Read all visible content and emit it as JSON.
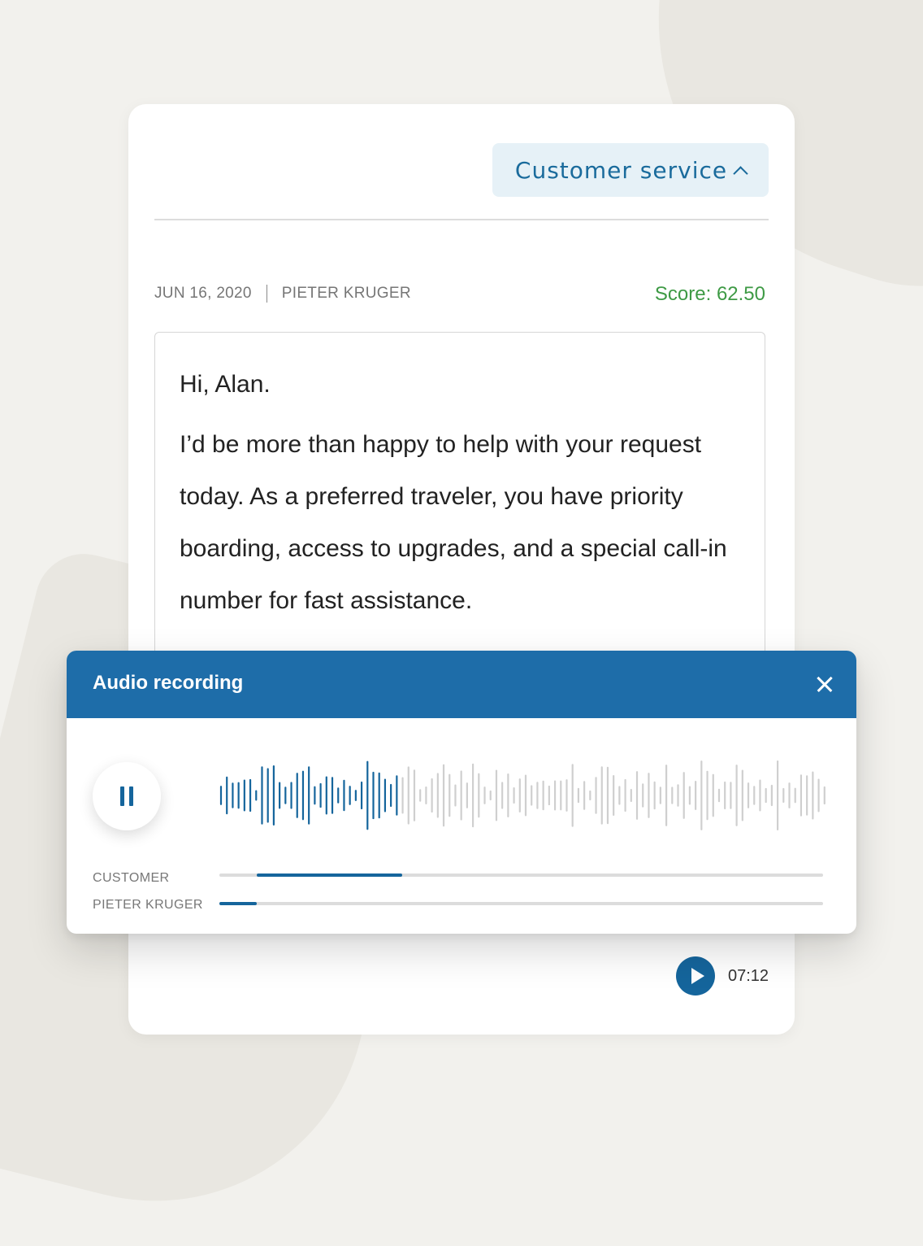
{
  "conversation": {
    "topic_label": "Customer service",
    "date": "JUN 16, 2020",
    "agent": "PIETER KRUGER",
    "score": "Score: 62.50",
    "greeting": "Hi, Alan.",
    "message": "I’d be more than happy to help with your request today. As a preferred traveler, you have priority boarding, access to upgrades, and a special call-in number for fast assistance.",
    "duration": "07:12"
  },
  "audio": {
    "title": "Audio recording",
    "played_fraction": 0.3,
    "tracks": [
      {
        "label": "CUSTOMER",
        "segment_start": 0.062,
        "segment_end": 0.303
      },
      {
        "label": "PIETER KRUGER",
        "segment_start": 0.0,
        "segment_end": 0.062
      }
    ]
  },
  "colors": {
    "accent": "#1e6da9",
    "waveform_played": "#15659c",
    "waveform_unplayed": "#cfcfcf",
    "score": "#3e9a45"
  },
  "icons": [
    "chevron-up-icon",
    "close-icon",
    "pause-icon",
    "play-icon"
  ]
}
